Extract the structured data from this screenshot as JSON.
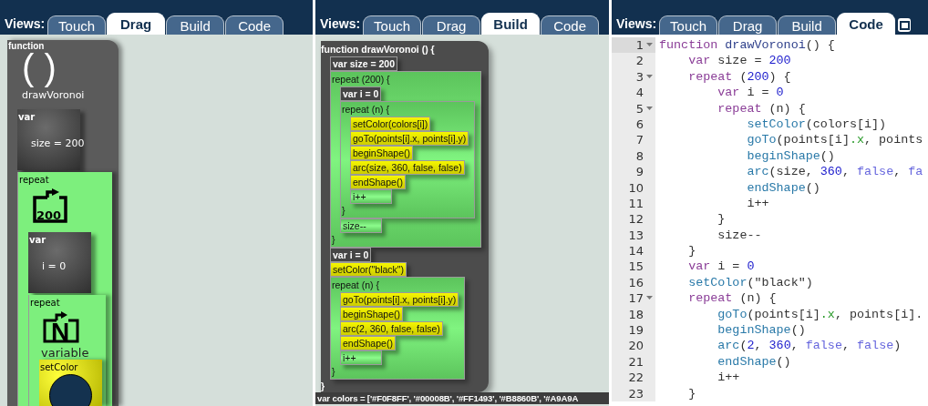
{
  "panels": [
    {
      "kind": "drag",
      "views_label": "Views:",
      "tabs": [
        {
          "label": "Touch",
          "selected": false
        },
        {
          "label": "Drag",
          "selected": true
        },
        {
          "label": "Build",
          "selected": false
        },
        {
          "label": "Code",
          "selected": false
        }
      ],
      "script": {
        "kind": "function",
        "label": "function",
        "icon_text": "( )",
        "name": "drawVoronoi",
        "children": [
          {
            "kind": "var",
            "label": "var",
            "text": "size = 200"
          },
          {
            "kind": "repeat",
            "label": "repeat",
            "count": "200",
            "children": [
              {
                "kind": "var",
                "label": "var",
                "text": "i = 0"
              },
              {
                "kind": "repeat",
                "label": "repeat",
                "icon_letter": "N",
                "caption": "variable",
                "children": [
                  {
                    "kind": "call",
                    "label": "setColor",
                    "color": "#14324f"
                  }
                ]
              }
            ]
          }
        ]
      }
    },
    {
      "kind": "build",
      "views_label": "Views:",
      "tabs": [
        {
          "label": "Touch",
          "selected": false
        },
        {
          "label": "Drag",
          "selected": false
        },
        {
          "label": "Build",
          "selected": true
        },
        {
          "label": "Code",
          "selected": false
        }
      ],
      "script": {
        "kind": "function",
        "header": "function drawVoronoi () {",
        "footer": "}",
        "children": [
          {
            "kind": "var",
            "text": "var size = 200"
          },
          {
            "kind": "repeat",
            "header": "repeat (200) {",
            "footer": "}",
            "children": [
              {
                "kind": "var",
                "text": "var i = 0"
              },
              {
                "kind": "repeat",
                "header": "repeat (n) {",
                "footer": "}",
                "children": [
                  {
                    "kind": "call",
                    "text": "setColor(colors[i])"
                  },
                  {
                    "kind": "call",
                    "text": "goTo(points[i].x, points[i].y)"
                  },
                  {
                    "kind": "call",
                    "text": "beginShape()"
                  },
                  {
                    "kind": "call",
                    "text": "arc(size, 360, false, false)"
                  },
                  {
                    "kind": "call",
                    "text": "endShape()"
                  },
                  {
                    "kind": "stmt",
                    "text": "i++"
                  }
                ]
              },
              {
                "kind": "stmt",
                "text": "size--"
              }
            ]
          },
          {
            "kind": "var",
            "text": "var i = 0"
          },
          {
            "kind": "call",
            "text": "setColor(\"black\")"
          },
          {
            "kind": "repeat",
            "header": "repeat (n) {",
            "footer": "}",
            "children": [
              {
                "kind": "call",
                "text": "goTo(points[i].x, points[i].y)"
              },
              {
                "kind": "call",
                "text": "beginShape()"
              },
              {
                "kind": "call",
                "text": "arc(2, 360, false, false)"
              },
              {
                "kind": "call",
                "text": "endShape()"
              },
              {
                "kind": "stmt",
                "text": "i++"
              }
            ]
          }
        ]
      },
      "footer_bar": "var colors = ['#F0F8FF', '#00008B', '#FF1493', '#B8860B', '#A9A9A"
    },
    {
      "kind": "code",
      "views_label": "Views:",
      "tabs": [
        {
          "label": "Touch",
          "selected": false
        },
        {
          "label": "Drag",
          "selected": false
        },
        {
          "label": "Build",
          "selected": false
        },
        {
          "label": "Code",
          "selected": true
        }
      ],
      "lines": [
        {
          "number": "1",
          "fold": true,
          "active": true,
          "tokens": [
            {
              "kind": "kw",
              "text": "function "
            },
            {
              "kind": "def",
              "text": "drawVoronoi"
            },
            {
              "kind": "plain",
              "text": "() {"
            }
          ]
        },
        {
          "number": "2",
          "fold": false,
          "active": false,
          "tokens": [
            {
              "kind": "kw",
              "text": "    var"
            },
            {
              "kind": "plain",
              "text": " size = "
            },
            {
              "kind": "num",
              "text": "200"
            }
          ]
        },
        {
          "number": "3",
          "fold": true,
          "active": false,
          "tokens": [
            {
              "kind": "kw",
              "text": "    repeat"
            },
            {
              "kind": "plain",
              "text": " ("
            },
            {
              "kind": "num",
              "text": "200"
            },
            {
              "kind": "plain",
              "text": ") {"
            }
          ]
        },
        {
          "number": "4",
          "fold": false,
          "active": false,
          "tokens": [
            {
              "kind": "kw",
              "text": "        var"
            },
            {
              "kind": "plain",
              "text": " i = "
            },
            {
              "kind": "num",
              "text": "0"
            }
          ]
        },
        {
          "number": "5",
          "fold": true,
          "active": false,
          "tokens": [
            {
              "kind": "kw",
              "text": "        repeat"
            },
            {
              "kind": "plain",
              "text": " (n) {"
            }
          ]
        },
        {
          "number": "6",
          "fold": false,
          "active": false,
          "tokens": [
            {
              "kind": "fn",
              "text": "            setColor"
            },
            {
              "kind": "plain",
              "text": "(colors[i])"
            }
          ]
        },
        {
          "number": "7",
          "fold": false,
          "active": false,
          "tokens": [
            {
              "kind": "fn",
              "text": "            goTo"
            },
            {
              "kind": "plain",
              "text": "(points[i]"
            },
            {
              "kind": "prop",
              "text": ".x"
            },
            {
              "kind": "plain",
              "text": ", points"
            }
          ]
        },
        {
          "number": "8",
          "fold": false,
          "active": false,
          "tokens": [
            {
              "kind": "fn",
              "text": "            beginShape"
            },
            {
              "kind": "plain",
              "text": "()"
            }
          ]
        },
        {
          "number": "9",
          "fold": false,
          "active": false,
          "tokens": [
            {
              "kind": "fn",
              "text": "            arc"
            },
            {
              "kind": "plain",
              "text": "(size, "
            },
            {
              "kind": "num",
              "text": "360"
            },
            {
              "kind": "plain",
              "text": ", "
            },
            {
              "kind": "bool",
              "text": "false"
            },
            {
              "kind": "plain",
              "text": ", "
            },
            {
              "kind": "bool",
              "text": "fa"
            }
          ]
        },
        {
          "number": "10",
          "fold": false,
          "active": false,
          "tokens": [
            {
              "kind": "fn",
              "text": "            endShape"
            },
            {
              "kind": "plain",
              "text": "()"
            }
          ]
        },
        {
          "number": "11",
          "fold": false,
          "active": false,
          "tokens": [
            {
              "kind": "plain",
              "text": "            i++"
            }
          ]
        },
        {
          "number": "12",
          "fold": false,
          "active": false,
          "tokens": [
            {
              "kind": "plain",
              "text": "        }"
            }
          ]
        },
        {
          "number": "13",
          "fold": false,
          "active": false,
          "tokens": [
            {
              "kind": "plain",
              "text": "        size--"
            }
          ]
        },
        {
          "number": "14",
          "fold": false,
          "active": false,
          "tokens": [
            {
              "kind": "plain",
              "text": "    }"
            }
          ]
        },
        {
          "number": "15",
          "fold": false,
          "active": false,
          "tokens": [
            {
              "kind": "kw",
              "text": "    var"
            },
            {
              "kind": "plain",
              "text": " i = "
            },
            {
              "kind": "num",
              "text": "0"
            }
          ]
        },
        {
          "number": "16",
          "fold": false,
          "active": false,
          "tokens": [
            {
              "kind": "fn",
              "text": "    setColor"
            },
            {
              "kind": "plain",
              "text": "(\"black\")"
            }
          ]
        },
        {
          "number": "17",
          "fold": true,
          "active": false,
          "tokens": [
            {
              "kind": "kw",
              "text": "    repeat"
            },
            {
              "kind": "plain",
              "text": " (n) {"
            }
          ]
        },
        {
          "number": "18",
          "fold": false,
          "active": false,
          "tokens": [
            {
              "kind": "fn",
              "text": "        goTo"
            },
            {
              "kind": "plain",
              "text": "(points[i]"
            },
            {
              "kind": "prop",
              "text": ".x"
            },
            {
              "kind": "plain",
              "text": ", points[i]."
            }
          ]
        },
        {
          "number": "19",
          "fold": false,
          "active": false,
          "tokens": [
            {
              "kind": "fn",
              "text": "        beginShape"
            },
            {
              "kind": "plain",
              "text": "()"
            }
          ]
        },
        {
          "number": "20",
          "fold": false,
          "active": false,
          "tokens": [
            {
              "kind": "fn",
              "text": "        arc"
            },
            {
              "kind": "plain",
              "text": "("
            },
            {
              "kind": "num",
              "text": "2"
            },
            {
              "kind": "plain",
              "text": ", "
            },
            {
              "kind": "num",
              "text": "360"
            },
            {
              "kind": "plain",
              "text": ", "
            },
            {
              "kind": "bool",
              "text": "false"
            },
            {
              "kind": "plain",
              "text": ", "
            },
            {
              "kind": "bool",
              "text": "false"
            },
            {
              "kind": "plain",
              "text": ")"
            }
          ]
        },
        {
          "number": "21",
          "fold": false,
          "active": false,
          "tokens": [
            {
              "kind": "fn",
              "text": "        endShape"
            },
            {
              "kind": "plain",
              "text": "()"
            }
          ]
        },
        {
          "number": "22",
          "fold": false,
          "active": false,
          "tokens": [
            {
              "kind": "plain",
              "text": "        i++"
            }
          ]
        },
        {
          "number": "23",
          "fold": false,
          "active": false,
          "tokens": [
            {
              "kind": "plain",
              "text": "    }"
            }
          ]
        }
      ]
    }
  ]
}
